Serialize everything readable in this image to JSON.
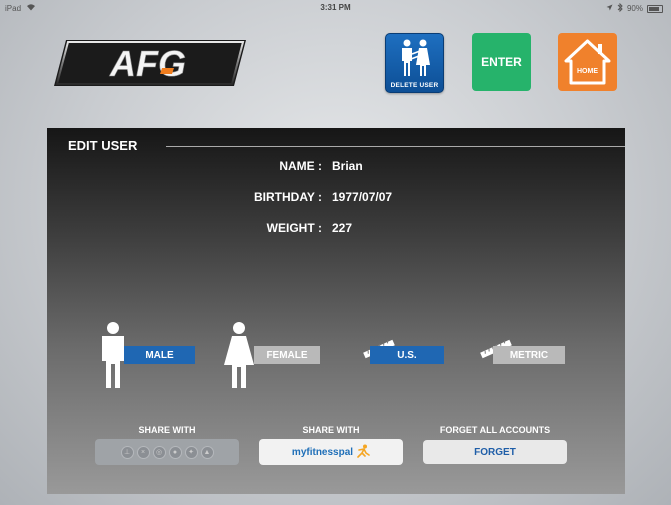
{
  "status_bar": {
    "device": "iPad",
    "time": "3:31 PM",
    "battery": "90%"
  },
  "logo": {
    "text": "AFG"
  },
  "toolbar": {
    "delete_user_label": "DELETE USER",
    "enter_label": "ENTER",
    "home_label": "HOME"
  },
  "panel": {
    "title": "EDIT USER",
    "fields": [
      {
        "label": "NAME :",
        "value": "Brian"
      },
      {
        "label": "BIRTHDAY :",
        "value": "1977/07/07"
      },
      {
        "label": "WEIGHT :",
        "value": "227"
      }
    ],
    "gender": {
      "male_label": "MALE",
      "female_label": "FEMALE",
      "selected": "MALE"
    },
    "units": {
      "us_label": "U.S.",
      "metric_label": "METRIC",
      "selected": "U.S."
    },
    "share": {
      "share_with_1": "SHARE WITH",
      "share_with_2": "SHARE WITH",
      "myfitnesspal_label": "myfitnesspal",
      "forget_heading": "FORGET ALL ACCOUNTS",
      "forget_button": "FORGET"
    }
  },
  "colors": {
    "accent_blue": "#1f67b3",
    "enter_green": "#26b36b",
    "home_orange": "#f0812c"
  }
}
